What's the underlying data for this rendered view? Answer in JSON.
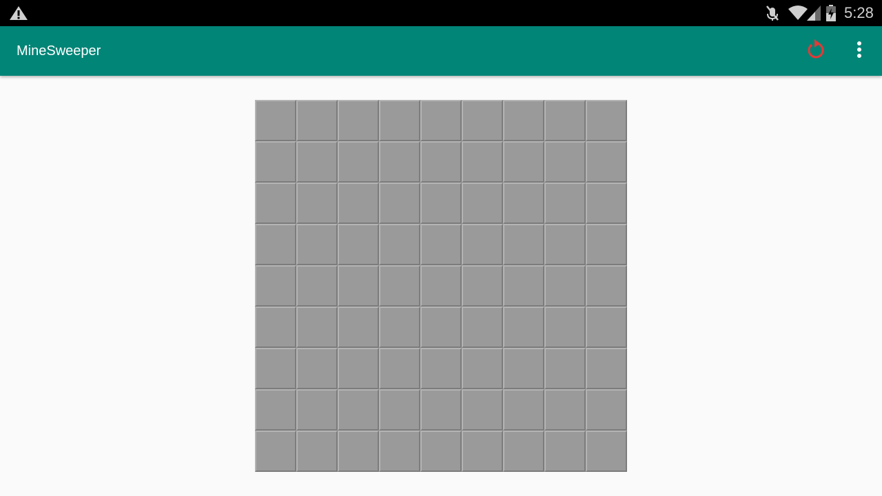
{
  "status_bar": {
    "time": "5:28",
    "icons": [
      "warning-icon",
      "mute-icon",
      "wifi-icon",
      "cell-signal-icon",
      "battery-charging-icon"
    ]
  },
  "app_bar": {
    "title": "MineSweeper",
    "actions": [
      "restart-icon",
      "overflow-menu-icon"
    ],
    "background_color": "#008577",
    "restart_icon_color": "#e53935"
  },
  "board": {
    "rows": 9,
    "columns": 9,
    "cell_state": "unrevealed",
    "cell_color": "#9a9a9a"
  }
}
